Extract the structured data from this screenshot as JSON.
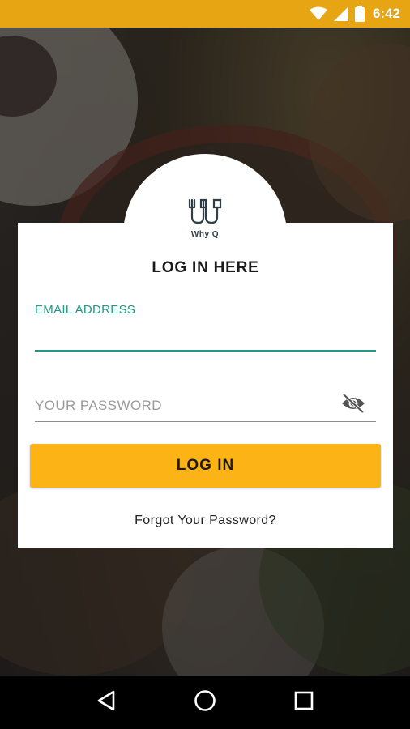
{
  "status_bar": {
    "time": "6:42",
    "icons": [
      "wifi-icon",
      "signal-icon",
      "battery-icon"
    ],
    "background_color": "#E7A413"
  },
  "logo": {
    "text": "Why Q",
    "icon": "utensils-logo-icon"
  },
  "login": {
    "title": "LOG IN HERE",
    "email_label": "EMAIL ADDRESS",
    "email_value": "",
    "password_placeholder": "YOUR PASSWORD",
    "password_value": "",
    "password_toggle_icon": "eye-off-icon",
    "login_button_label": "LOG IN",
    "forgot_password_label": "Forgot Your Password?"
  },
  "colors": {
    "accent": "#1e9a86",
    "button": "#FCB316",
    "status_bar": "#E7A413"
  },
  "nav_bar": {
    "buttons": [
      "back-icon",
      "home-icon",
      "recents-icon"
    ]
  }
}
